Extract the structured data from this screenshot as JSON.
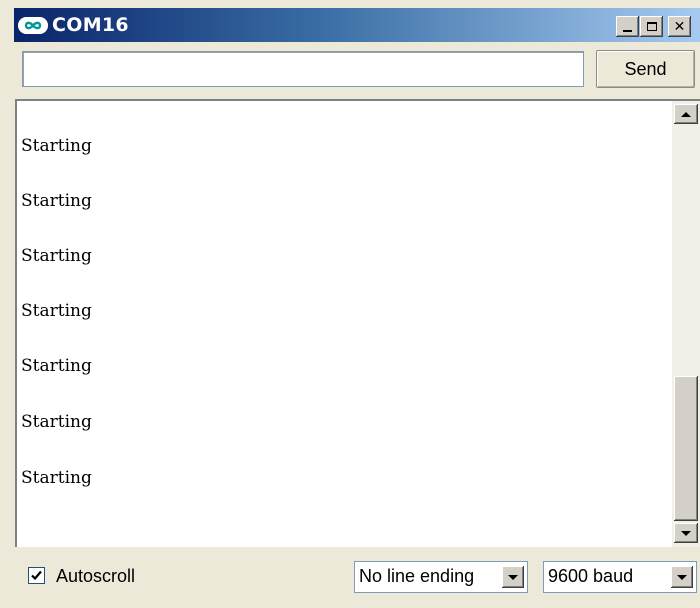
{
  "window": {
    "title": "COM16",
    "title_bar_colors": [
      "#0a246a",
      "#3a6ea5",
      "#a6caf0"
    ],
    "icons": {
      "app": "arduino-infinity-icon",
      "minimize": "minimize-icon",
      "maximize": "maximize-icon",
      "close": "close-icon"
    },
    "close_glyph": "✕"
  },
  "send_bar": {
    "input_value": "",
    "send_label": "Send"
  },
  "output": {
    "lines": [
      "Starting",
      "Starting",
      "Starting",
      "Starting",
      "Starting",
      "Starting",
      "Starting"
    ]
  },
  "scrollbar": {
    "icons": {
      "up": "scroll-up-arrow-icon",
      "down": "scroll-down-arrow-icon"
    }
  },
  "footer": {
    "autoscroll": {
      "label": "Autoscroll",
      "checked": true
    },
    "line_ending": {
      "selected": "No line ending"
    },
    "baud_rate": {
      "selected": "9600 baud"
    }
  }
}
